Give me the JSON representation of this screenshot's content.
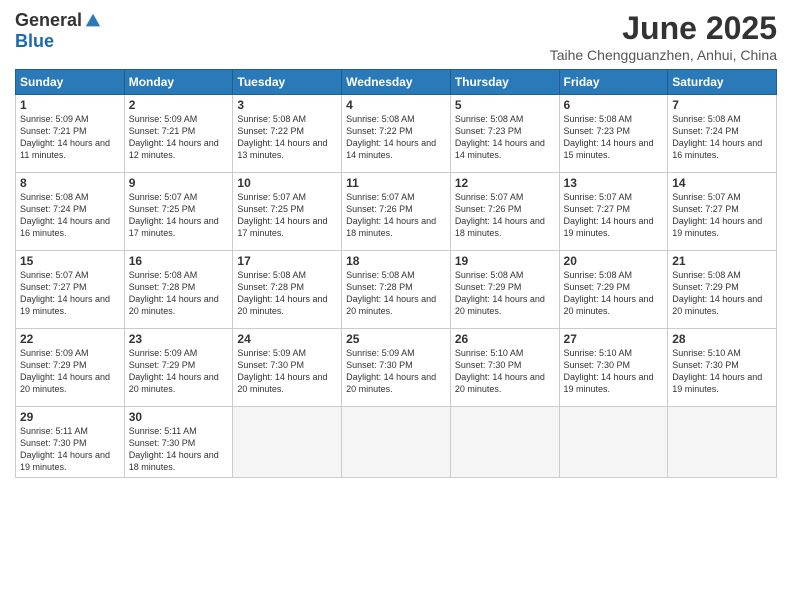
{
  "logo": {
    "general": "General",
    "blue": "Blue"
  },
  "title": "June 2025",
  "location": "Taihe Chengguanzhen, Anhui, China",
  "days_header": [
    "Sunday",
    "Monday",
    "Tuesday",
    "Wednesday",
    "Thursday",
    "Friday",
    "Saturday"
  ],
  "weeks": [
    [
      {
        "day": "1",
        "sunrise": "5:09 AM",
        "sunset": "7:21 PM",
        "daylight": "14 hours and 11 minutes."
      },
      {
        "day": "2",
        "sunrise": "5:09 AM",
        "sunset": "7:21 PM",
        "daylight": "14 hours and 12 minutes."
      },
      {
        "day": "3",
        "sunrise": "5:08 AM",
        "sunset": "7:22 PM",
        "daylight": "14 hours and 13 minutes."
      },
      {
        "day": "4",
        "sunrise": "5:08 AM",
        "sunset": "7:22 PM",
        "daylight": "14 hours and 14 minutes."
      },
      {
        "day": "5",
        "sunrise": "5:08 AM",
        "sunset": "7:23 PM",
        "daylight": "14 hours and 14 minutes."
      },
      {
        "day": "6",
        "sunrise": "5:08 AM",
        "sunset": "7:23 PM",
        "daylight": "14 hours and 15 minutes."
      },
      {
        "day": "7",
        "sunrise": "5:08 AM",
        "sunset": "7:24 PM",
        "daylight": "14 hours and 16 minutes."
      }
    ],
    [
      {
        "day": "8",
        "sunrise": "5:08 AM",
        "sunset": "7:24 PM",
        "daylight": "14 hours and 16 minutes."
      },
      {
        "day": "9",
        "sunrise": "5:07 AM",
        "sunset": "7:25 PM",
        "daylight": "14 hours and 17 minutes."
      },
      {
        "day": "10",
        "sunrise": "5:07 AM",
        "sunset": "7:25 PM",
        "daylight": "14 hours and 17 minutes."
      },
      {
        "day": "11",
        "sunrise": "5:07 AM",
        "sunset": "7:26 PM",
        "daylight": "14 hours and 18 minutes."
      },
      {
        "day": "12",
        "sunrise": "5:07 AM",
        "sunset": "7:26 PM",
        "daylight": "14 hours and 18 minutes."
      },
      {
        "day": "13",
        "sunrise": "5:07 AM",
        "sunset": "7:27 PM",
        "daylight": "14 hours and 19 minutes."
      },
      {
        "day": "14",
        "sunrise": "5:07 AM",
        "sunset": "7:27 PM",
        "daylight": "14 hours and 19 minutes."
      }
    ],
    [
      {
        "day": "15",
        "sunrise": "5:07 AM",
        "sunset": "7:27 PM",
        "daylight": "14 hours and 19 minutes."
      },
      {
        "day": "16",
        "sunrise": "5:08 AM",
        "sunset": "7:28 PM",
        "daylight": "14 hours and 20 minutes."
      },
      {
        "day": "17",
        "sunrise": "5:08 AM",
        "sunset": "7:28 PM",
        "daylight": "14 hours and 20 minutes."
      },
      {
        "day": "18",
        "sunrise": "5:08 AM",
        "sunset": "7:28 PM",
        "daylight": "14 hours and 20 minutes."
      },
      {
        "day": "19",
        "sunrise": "5:08 AM",
        "sunset": "7:29 PM",
        "daylight": "14 hours and 20 minutes."
      },
      {
        "day": "20",
        "sunrise": "5:08 AM",
        "sunset": "7:29 PM",
        "daylight": "14 hours and 20 minutes."
      },
      {
        "day": "21",
        "sunrise": "5:08 AM",
        "sunset": "7:29 PM",
        "daylight": "14 hours and 20 minutes."
      }
    ],
    [
      {
        "day": "22",
        "sunrise": "5:09 AM",
        "sunset": "7:29 PM",
        "daylight": "14 hours and 20 minutes."
      },
      {
        "day": "23",
        "sunrise": "5:09 AM",
        "sunset": "7:29 PM",
        "daylight": "14 hours and 20 minutes."
      },
      {
        "day": "24",
        "sunrise": "5:09 AM",
        "sunset": "7:30 PM",
        "daylight": "14 hours and 20 minutes."
      },
      {
        "day": "25",
        "sunrise": "5:09 AM",
        "sunset": "7:30 PM",
        "daylight": "14 hours and 20 minutes."
      },
      {
        "day": "26",
        "sunrise": "5:10 AM",
        "sunset": "7:30 PM",
        "daylight": "14 hours and 20 minutes."
      },
      {
        "day": "27",
        "sunrise": "5:10 AM",
        "sunset": "7:30 PM",
        "daylight": "14 hours and 19 minutes."
      },
      {
        "day": "28",
        "sunrise": "5:10 AM",
        "sunset": "7:30 PM",
        "daylight": "14 hours and 19 minutes."
      }
    ],
    [
      {
        "day": "29",
        "sunrise": "5:11 AM",
        "sunset": "7:30 PM",
        "daylight": "14 hours and 19 minutes."
      },
      {
        "day": "30",
        "sunrise": "5:11 AM",
        "sunset": "7:30 PM",
        "daylight": "14 hours and 18 minutes."
      },
      null,
      null,
      null,
      null,
      null
    ]
  ]
}
